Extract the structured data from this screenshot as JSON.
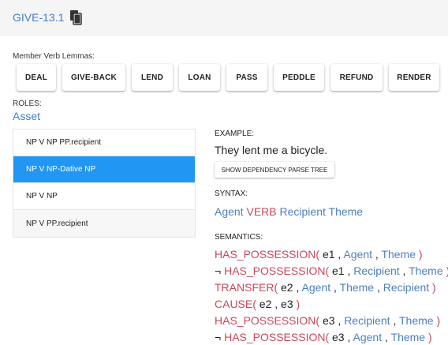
{
  "header": {
    "class_id": "GIVE-13.1",
    "copy_icon": "copy-icon"
  },
  "lemmas": {
    "label": "Member Verb Lemmas:",
    "items": [
      "DEAL",
      "GIVE-BACK",
      "LEND",
      "LOAN",
      "PASS",
      "PEDDLE",
      "REFUND",
      "RENDER"
    ]
  },
  "roles": {
    "label": "ROLES:",
    "current": "Asset"
  },
  "frames": [
    "NP V NP PP.recipient",
    "NP V NP-Dative NP",
    "NP V NP",
    "NP V PP.recipient"
  ],
  "frames_selected_index": 1,
  "example": {
    "label": "EXAMPLE:",
    "text": "They lent me a bicycle.",
    "button": "SHOW DEPENDENCY PARSE TREE"
  },
  "syntax": {
    "label": "SYNTAX:",
    "tokens": [
      "Agent",
      "VERB",
      "Recipient",
      "Theme"
    ]
  },
  "semantics": {
    "label": "SEMANTICS:",
    "lines": [
      {
        "neg": "",
        "pred": "HAS_POSSESSION(",
        "args": [
          "e1",
          "Agent",
          "Theme"
        ],
        "close": ")"
      },
      {
        "neg": "¬",
        "pred": "HAS_POSSESSION(",
        "args": [
          "e1",
          "Recipient",
          "Theme"
        ],
        "close": ")"
      },
      {
        "neg": "",
        "pred": "TRANSFER(",
        "args": [
          "e2",
          "Agent",
          "Theme",
          "Recipient"
        ],
        "close": ")"
      },
      {
        "neg": "",
        "pred": "CAUSE(",
        "args": [
          "e2",
          "e3"
        ],
        "close": ")"
      },
      {
        "neg": "",
        "pred": "HAS_POSSESSION(",
        "args": [
          "e3",
          "Recipient",
          "Theme"
        ],
        "close": ")"
      },
      {
        "neg": "¬",
        "pred": "HAS_POSSESSION(",
        "args": [
          "e3",
          "Agent",
          "Theme"
        ],
        "close": ")"
      }
    ]
  },
  "colors": {
    "link_blue": "#3f7fd0",
    "role_blue": "#4f7fba",
    "predicate_red": "#c8485a",
    "selected_bg": "#2196f3"
  }
}
